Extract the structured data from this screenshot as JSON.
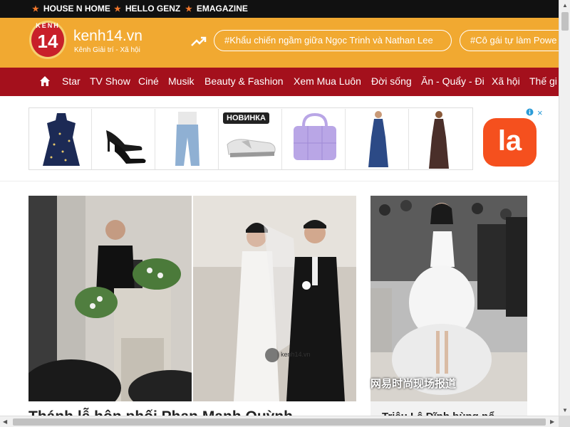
{
  "topbar": {
    "items": [
      "HOUSE N HOME",
      "HELLO GENZ",
      "EMAGAZINE"
    ]
  },
  "header": {
    "logo_kenh": "KENH",
    "logo_14": "14",
    "brand": "kenh14.vn",
    "tagline": "Kênh Giải trí - Xã hội",
    "trending_tags": [
      "#Khẩu chiến ngầm giữa Ngọc Trinh và Nathan Lee",
      "#Cô gái tự làm Powe"
    ]
  },
  "nav": {
    "items": [
      "Star",
      "TV Show",
      "Ciné",
      "Musik",
      "Beauty & Fashion",
      "Xem Mua Luôn",
      "Đời sống",
      "Ăn - Quẩy - Đi",
      "Xã hội",
      "Thế gi"
    ]
  },
  "ad": {
    "badge": "НОВИНКА",
    "logo_text": "la",
    "close_icon": "×"
  },
  "main": {
    "headline": "Thánh lễ hôn phối Phan Mạnh Quỳnh",
    "photo_watermark": "kenh14.vn",
    "side_watermark": "网易时尚现场报道",
    "side_headline": "Triệu Lệ Dĩnh bùng nổ"
  },
  "colors": {
    "topbar": "#111111",
    "header": "#f1a931",
    "nav": "#a4101c",
    "star": "#f0762b"
  }
}
